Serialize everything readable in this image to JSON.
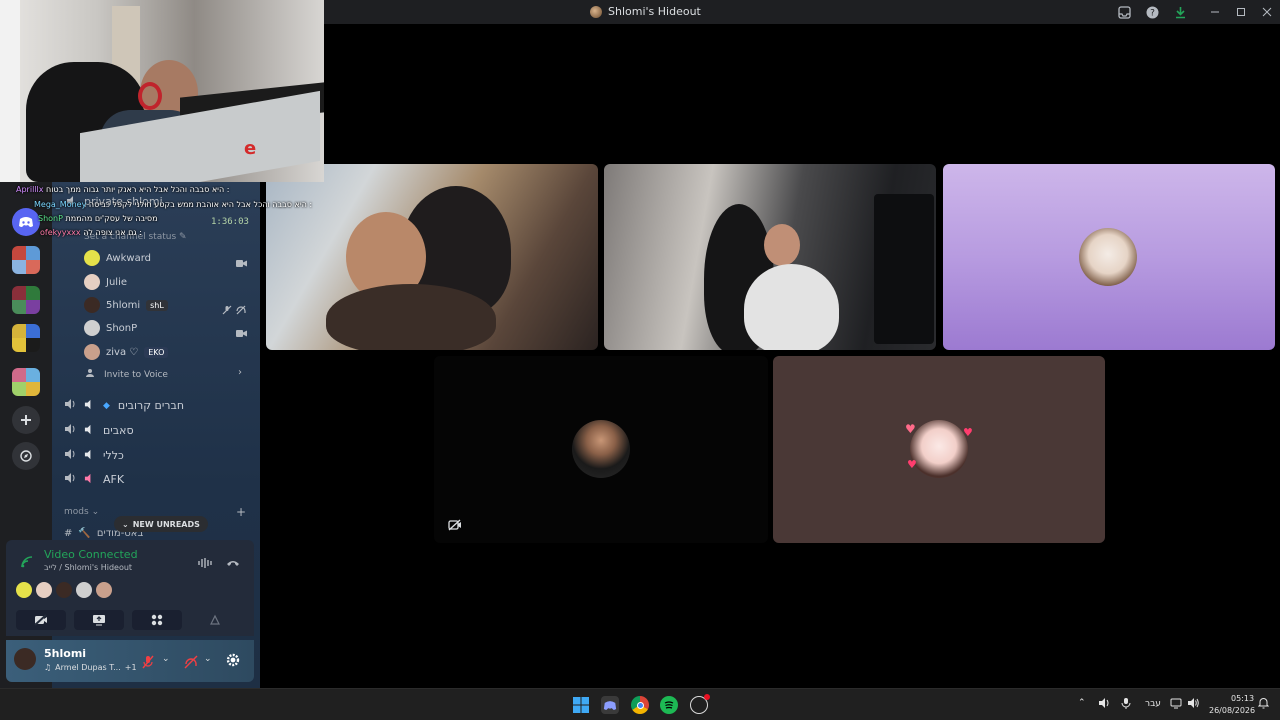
{
  "window": {
    "title": "Shlomi's Hideout"
  },
  "sidebar": {
    "channel_title": "private shlomi",
    "timer": "1:36:03",
    "set_status": "Set a channel status",
    "members": [
      {
        "name": "Awkward",
        "badge": "",
        "color": "#e5e14a"
      },
      {
        "name": "Julie",
        "badge": "",
        "color": "#e6cfc2"
      },
      {
        "name": "5hlomi",
        "badge": "shL",
        "color": "#3b2a24"
      },
      {
        "name": "ShonP",
        "badge": "",
        "color": "#cfcfcf"
      },
      {
        "name": "ziva ♡",
        "badge": "EKO",
        "color": "#c9a08c"
      }
    ],
    "invite": "Invite to Voice",
    "voice_channels": [
      {
        "name": "חברים קרובים"
      },
      {
        "name": "סאבים"
      },
      {
        "name": "כללי"
      },
      {
        "name": "AFK"
      }
    ],
    "category": "mods",
    "new_unreads": "NEW UNREADS",
    "partial_channel": "באט-מודים"
  },
  "chat_overlay": [
    {
      "user": "Aprilllx",
      "text": "היא סבבה והכל אבל היא ראנק יותר גבוה ממך בטוח :"
    },
    {
      "user": "Mega_Money",
      "text": "היא סבבה והכל אבל היא אוהבת ממש בקטע חולני לקפל כביסה :"
    },
    {
      "user": "ShonP",
      "text": "מסיבה של עסק'ים מהממת"
    },
    {
      "user": "ofekyyxxx",
      "text": "גם אני צופה לה :"
    }
  ],
  "voice_panel": {
    "status": "Video Connected",
    "location": "לייב / Shlomi's Hideout",
    "status_color": "#23a55a"
  },
  "user_panel": {
    "username": "5hlomi",
    "activity": "Armel Dupas T...",
    "extra": "+1"
  },
  "taskbar": {
    "lang": "עבר",
    "time": "05:13",
    "date": "26/08/2026"
  }
}
